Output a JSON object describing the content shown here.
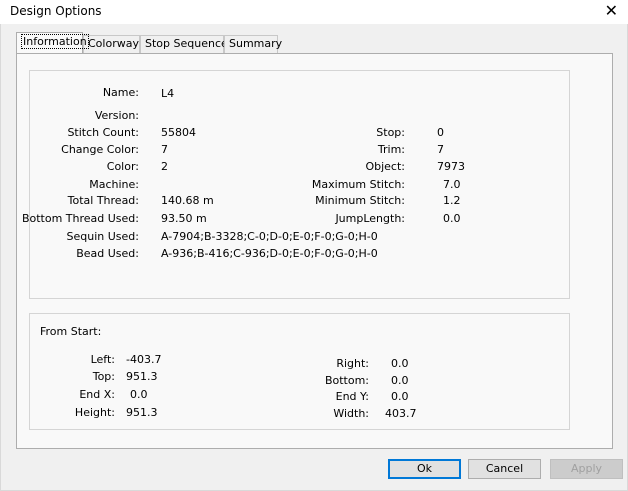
{
  "window": {
    "title": "Design Options",
    "close_label": "✕"
  },
  "tabs": [
    {
      "label": "Information"
    },
    {
      "label": "Colorway"
    },
    {
      "label": "Stop Sequence"
    },
    {
      "label": "Summary"
    }
  ],
  "info": {
    "name_label": "Name:",
    "name_value": "L4",
    "version_label": "Version:",
    "version_value": "",
    "stitch_count_label": "Stitch Count:",
    "stitch_count_value": "55804",
    "change_color_label": "Change Color:",
    "change_color_value": "7",
    "color_label": "Color:",
    "color_value": "2",
    "machine_label": "Machine:",
    "machine_value": "",
    "total_thread_label": "Total Thread:",
    "total_thread_value": "140.68 m",
    "bottom_thread_label": "Bottom Thread Used:",
    "bottom_thread_value": "93.50 m",
    "sequin_label": "Sequin Used:",
    "sequin_value": "A-7904;B-3328;C-0;D-0;E-0;F-0;G-0;H-0",
    "bead_label": "Bead Used:",
    "bead_value": "A-936;B-416;C-936;D-0;E-0;F-0;G-0;H-0",
    "stop_label": "Stop:",
    "stop_value": "0",
    "trim_label": "Trim:",
    "trim_value": "7",
    "object_label": "Object:",
    "object_value": "7973",
    "max_stitch_label": "Maximum Stitch:",
    "max_stitch_value": "7.0",
    "min_stitch_label": "Minimum Stitch:",
    "min_stitch_value": "1.2",
    "jump_label": "JumpLength:",
    "jump_value": "0.0"
  },
  "from_start": {
    "heading": "From Start:",
    "left_label": "Left:",
    "left_value": "-403.7",
    "top_label": "Top:",
    "top_value": "951.3",
    "endx_label": "End X:",
    "endx_value": "0.0",
    "height_label": "Height:",
    "height_value": "951.3",
    "right_label": "Right:",
    "right_value": "0.0",
    "bottom_label": "Bottom:",
    "bottom_value": "0.0",
    "endy_label": "End Y:",
    "endy_value": "0.0",
    "width_label": "Width:",
    "width_value": "403.7"
  },
  "buttons": {
    "ok": "Ok",
    "cancel": "Cancel",
    "apply": "Apply"
  },
  "colors": {
    "focus_border": "#0078d7",
    "disabled_text": "#a0a0a0"
  }
}
